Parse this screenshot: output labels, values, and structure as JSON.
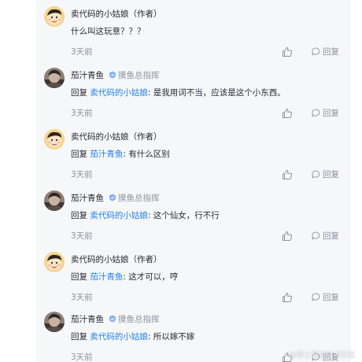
{
  "comments": [
    {
      "user": "卖代码的小姑娘",
      "author_tag": "（作者）",
      "title": "",
      "reply_prefix": "",
      "reply_target": "",
      "reply_sep": "",
      "text": "什么叫这玩意？？？",
      "time": "3天前",
      "reply_label": "回复",
      "avatar": "crayon-shin-chan"
    },
    {
      "user": "茄汁青鱼",
      "author_tag": "",
      "title": "摸鱼总指挥",
      "reply_prefix": "回复 ",
      "reply_target": "卖代码的小姑娘",
      "reply_sep": ": ",
      "text": "是我用词不当，应该是这个小东西。",
      "time": "3天前",
      "reply_label": "回复",
      "avatar": "photo"
    },
    {
      "user": "卖代码的小姑娘",
      "author_tag": "（作者）",
      "title": "",
      "reply_prefix": "回复 ",
      "reply_target": "茄汁青鱼",
      "reply_sep": ": ",
      "text": "有什么区别",
      "time": "3天前",
      "reply_label": "回复",
      "avatar": "crayon-shin-chan"
    },
    {
      "user": "茄汁青鱼",
      "author_tag": "",
      "title": "摸鱼总指挥",
      "reply_prefix": "回复 ",
      "reply_target": "卖代码的小姑娘",
      "reply_sep": ": ",
      "text": "这个仙女，行不行",
      "time": "3天前",
      "reply_label": "回复",
      "avatar": "photo"
    },
    {
      "user": "卖代码的小姑娘",
      "author_tag": "（作者）",
      "title": "",
      "reply_prefix": "回复 ",
      "reply_target": "茄汁青鱼",
      "reply_sep": ": ",
      "text": "这才可以，哼",
      "time": "3天前",
      "reply_label": "回复",
      "avatar": "crayon-shin-chan"
    },
    {
      "user": "茄汁青鱼",
      "author_tag": "",
      "title": "摸鱼总指挥",
      "reply_prefix": "回复 ",
      "reply_target": "卖代码的小姑娘",
      "reply_sep": ": ",
      "text": "所以嫁不嫁",
      "time": "3天前",
      "reply_label": "回复",
      "avatar": "photo"
    }
  ],
  "watermark": "@稀土掘金技术社区",
  "colors": {
    "panel_bg": "#f6f7f9",
    "text": "#252933",
    "muted": "#8a919f",
    "link": "#1e80ff",
    "title_badge": "#7fb1ff"
  }
}
